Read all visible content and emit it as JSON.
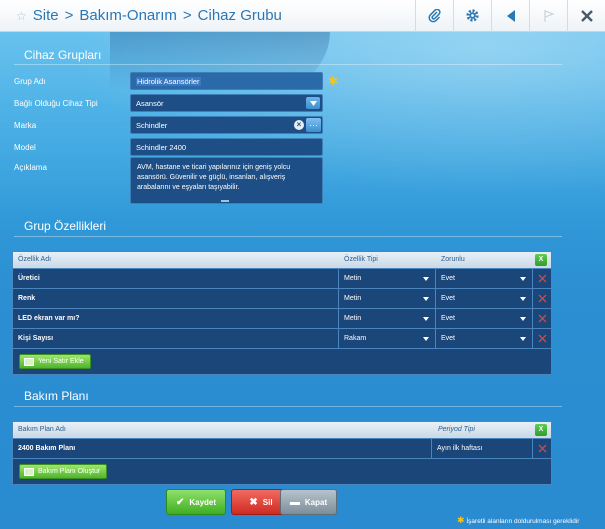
{
  "header": {
    "breadcrumb": [
      "Site",
      "Bakım-Onarım",
      "Cihaz Grubu"
    ],
    "separator": ">"
  },
  "sections": {
    "groups": "Cihaz Grupları",
    "features": "Grup Özellikleri",
    "maintenance": "Bakım Planı"
  },
  "form": {
    "group_name_label": "Grup Adı",
    "group_name_value": "Hidrolik Asansörler",
    "device_type_label": "Bağlı Olduğu Cihaz Tipi",
    "device_type_value": "Asansör",
    "brand_label": "Marka",
    "brand_value": "Schindler",
    "model_label": "Model",
    "model_value": "Schindler 2400",
    "description_label": "Açıklama",
    "description_value": "AVM, hastane ve ticari yapılarınız için geniş yolcu asansörü. Güvenilir ve güçlü, insanları, alışveriş arabalarını ve eşyaları taşıyabilir.",
    "required_mark": "✱"
  },
  "features_grid": {
    "headers": [
      "Özellik Adı",
      "Özellik Tipi",
      "Zorunlu"
    ],
    "add_header_label": "X",
    "rows": [
      {
        "name": "Üretici",
        "type": "Metin",
        "required": "Evet"
      },
      {
        "name": "Renk",
        "type": "Metin",
        "required": "Evet"
      },
      {
        "name": "LED ekran var mı?",
        "type": "Metin",
        "required": "Evet"
      },
      {
        "name": "Kişi Sayısı",
        "type": "Rakam",
        "required": "Evet"
      }
    ],
    "add_row_label": "Yeni Satır Ekle"
  },
  "maintenance_grid": {
    "headers": [
      "Bakım Plan Adı",
      "Periyod Tipi"
    ],
    "add_header_label": "X",
    "rows": [
      {
        "name": "2400 Bakım Planı",
        "period": "Ayın ilk haftası"
      }
    ],
    "create_label": "Bakım Planı Oluştur"
  },
  "actions": {
    "save": "Kaydet",
    "delete": "Sil",
    "close": "Kapat"
  },
  "footnote": "İşaretli alanların doldurulması gereklidir",
  "footnote_mark": "✱",
  "colors": {
    "accent": "#2a77b5",
    "field_bg": "#1d4f86",
    "grid_bg": "#1a467a",
    "save": "#5cc43a",
    "delete": "#e0322c",
    "close": "#8a9aa6",
    "required": "#f5c518"
  }
}
